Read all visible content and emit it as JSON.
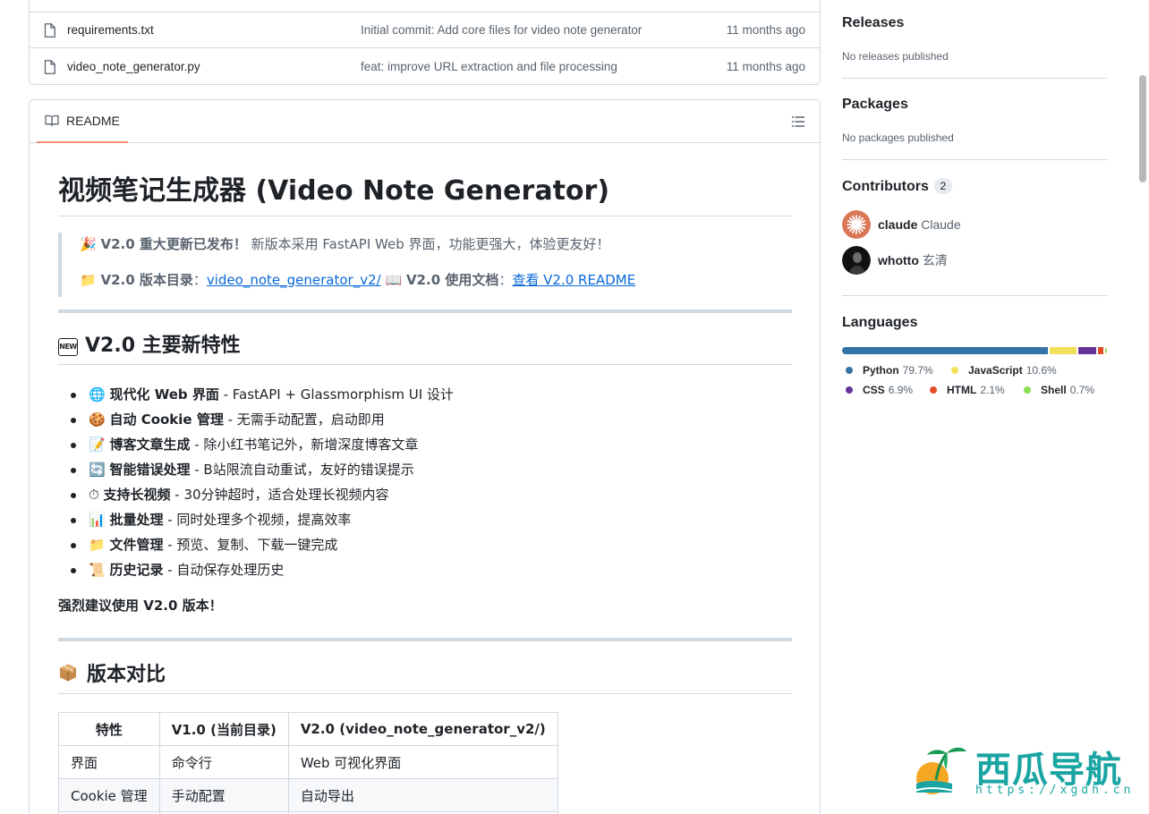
{
  "files": [
    {
      "name": "requirements.txt",
      "message": "Initial commit: Add core files for video note generator",
      "time": "11 months ago"
    },
    {
      "name": "video_note_generator.py",
      "message": "feat: improve URL extraction and file processing",
      "time": "11 months ago"
    }
  ],
  "readme": {
    "tab_label": "README",
    "title": "视频笔记生成器 (Video Note Generator)",
    "quote": {
      "line1_emoji": "🎉",
      "line1_bold": "V2.0 重大更新已发布！",
      "line1_text": " 新版本采用 FastAPI Web 界面，功能更强大，体验更友好！",
      "line2_emoji": "📁",
      "line2_bold1": "V2.0 版本目录",
      "line2_colon1": "：",
      "line2_link1": "video_note_generator_v2/",
      "line2_emoji2": "📖",
      "line2_bold2": "V2.0 使用文档",
      "line2_colon2": "：",
      "line2_link2": "查看 V2.0 README"
    },
    "h2_features": "V2.0 主要新特性",
    "new_badge": "NEW",
    "features": [
      {
        "emoji": "🌐",
        "bold": "现代化 Web 界面",
        "text": " - FastAPI + Glassmorphism UI 设计"
      },
      {
        "emoji": "🍪",
        "bold": "自动 Cookie 管理",
        "text": " - 无需手动配置，启动即用"
      },
      {
        "emoji": "📝",
        "bold": "博客文章生成",
        "text": " - 除小红书笔记外，新增深度博客文章"
      },
      {
        "emoji": "🔄",
        "bold": "智能错误处理",
        "text": " - B站限流自动重试，友好的错误提示"
      },
      {
        "emoji": "⏱",
        "bold": "支持长视频",
        "text": " - 30分钟超时，适合处理长视频内容"
      },
      {
        "emoji": "📊",
        "bold": "批量处理",
        "text": " - 同时处理多个视频，提高效率"
      },
      {
        "emoji": "📁",
        "bold": "文件管理",
        "text": " - 预览、复制、下载一键完成"
      },
      {
        "emoji": "📜",
        "bold": "历史记录",
        "text": " - 自动保存处理历史"
      }
    ],
    "strong_note": "强烈建议使用 V2.0 版本！",
    "h2_compare": "版本对比",
    "table": {
      "headers": [
        "特性",
        "V1.0 (当前目录)",
        "V2.0 (video_note_generator_v2/)"
      ],
      "rows": [
        [
          "界面",
          "命令行",
          "Web 可视化界面"
        ],
        [
          "Cookie 管理",
          "手动配置",
          "自动导出"
        ],
        [
          "",
          "",
          ""
        ]
      ]
    }
  },
  "sidebar": {
    "releases_title": "Releases",
    "releases_text": "No releases published",
    "packages_title": "Packages",
    "packages_text": "No packages published",
    "contributors_title": "Contributors",
    "contributors_count": "2",
    "contributors": [
      {
        "login": "claude",
        "alias": "Claude"
      },
      {
        "login": "whotto",
        "alias": "玄清"
      }
    ],
    "languages_title": "Languages",
    "languages": [
      {
        "name": "Python",
        "pct": "79.7%",
        "value": 79.7,
        "color": "#3572A5"
      },
      {
        "name": "JavaScript",
        "pct": "10.6%",
        "value": 10.6,
        "color": "#f1e05a"
      },
      {
        "name": "CSS",
        "pct": "6.9%",
        "value": 6.9,
        "color": "#663399"
      },
      {
        "name": "HTML",
        "pct": "2.1%",
        "value": 2.1,
        "color": "#e34c26"
      },
      {
        "name": "Shell",
        "pct": "0.7%",
        "value": 0.7,
        "color": "#89e051"
      }
    ]
  },
  "watermark": {
    "text": "西瓜导航",
    "url": "https://xgdh.cn"
  }
}
